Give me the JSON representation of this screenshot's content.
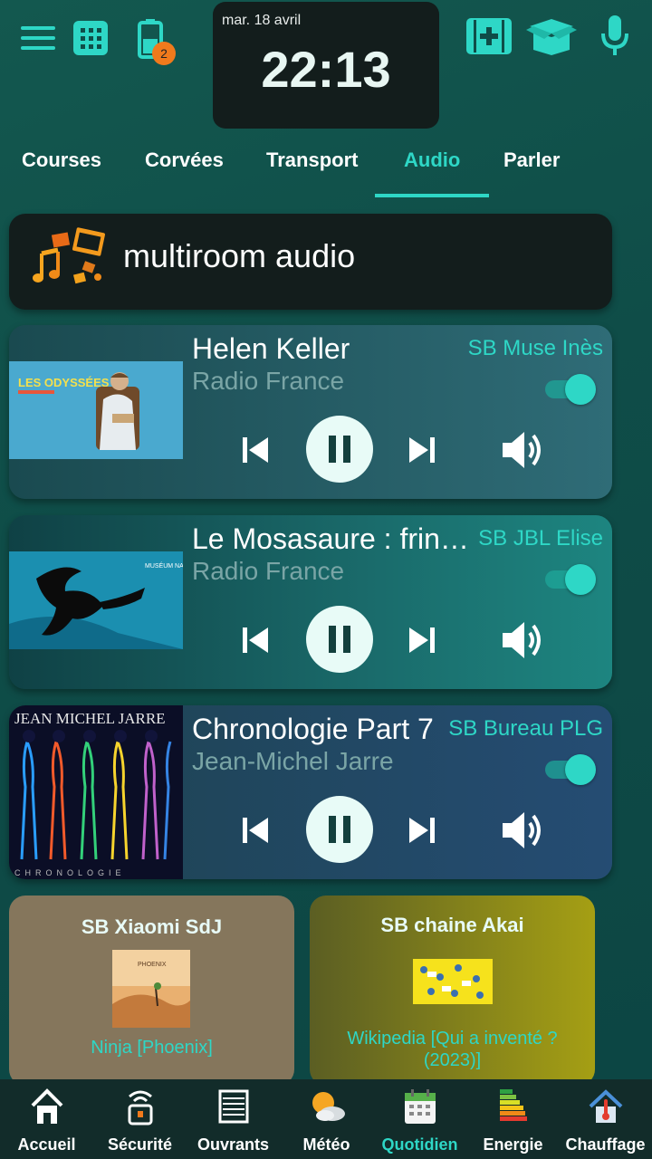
{
  "header": {
    "date": "mar. 18 avril",
    "time": "22:13",
    "battery_badge": "2",
    "icons": [
      "menu-icon",
      "grid-icon",
      "battery-icon",
      "medical-box-icon",
      "open-box-icon",
      "microphone-icon"
    ]
  },
  "tabs": [
    {
      "label": "Courses"
    },
    {
      "label": "Corvées"
    },
    {
      "label": "Transport"
    },
    {
      "label": "Audio",
      "active": true
    },
    {
      "label": "Parler"
    }
  ],
  "section": {
    "title": "multiroom audio"
  },
  "players": [
    {
      "title": "Helen Keller",
      "artist": "Radio France",
      "device": "SB Muse Inès",
      "enabled": true,
      "state": "playing"
    },
    {
      "title": "Le Mosasaure : fringant",
      "artist": "Radio France",
      "device": "SB JBL Elise",
      "enabled": true,
      "state": "playing"
    },
    {
      "title": "Chronologie Part 7",
      "artist": "Jean-Michel Jarre",
      "device": "SB Bureau PLG",
      "enabled": true,
      "state": "playing"
    }
  ],
  "cover_text": {
    "odyssees": "LES ODYSSÉES",
    "museum": "MUSÉUM NATIONAL D'HISTOIRE NATURELLE",
    "jarre_top": "JEAN MICHEL JARRE",
    "jarre_bottom": "CHRONOLOGIE",
    "phoenix": "PHOENIX"
  },
  "small_cards": [
    {
      "title": "SB Xiaomi SdJ",
      "track": "Ninja [Phoenix]"
    },
    {
      "title": "SB chaine Akai",
      "track": "Wikipedia [Qui a inventé ? (2023)]"
    }
  ],
  "bottom_nav": [
    {
      "label": "Accueil",
      "icon": "home-icon"
    },
    {
      "label": "Sécurité",
      "icon": "security-icon"
    },
    {
      "label": "Ouvrants",
      "icon": "shutter-icon"
    },
    {
      "label": "Météo",
      "icon": "weather-icon"
    },
    {
      "label": "Quotidien",
      "icon": "calendar-icon",
      "active": true
    },
    {
      "label": "Energie",
      "icon": "energy-icon"
    },
    {
      "label": "Chauffage",
      "icon": "heating-icon"
    }
  ],
  "colors": {
    "accent": "#2ed7c6",
    "background": "#0f4d48",
    "card_dark": "#131d1c",
    "badge": "#f07a1c"
  }
}
